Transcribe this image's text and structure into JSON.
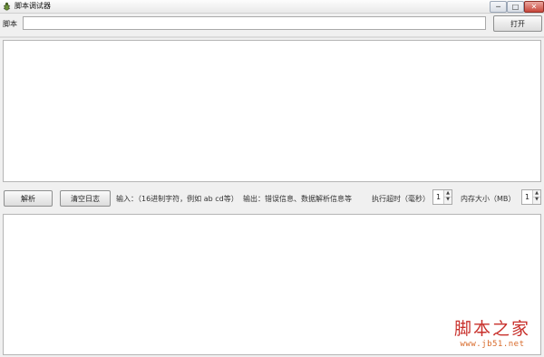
{
  "window": {
    "title": "脚本调试器",
    "icon": "bug-icon",
    "controls": {
      "minimize": "─",
      "maximize": "□",
      "close": "✕"
    }
  },
  "script_row": {
    "label": "脚本",
    "input_value": "",
    "open_button": "打开"
  },
  "toolbar": {
    "parse_button": "解析",
    "clear_log_button": "清空日志",
    "input_hint": "输入：（16进制字符，例如 ab cd等）",
    "output_hint": "输出：错误信息、数据解析信息等",
    "timeout_label": "执行超时（毫秒）",
    "timeout_value": "1",
    "memory_label": "内存大小（MB）",
    "memory_value": "1"
  },
  "watermark": {
    "logo_text": "脚本之家",
    "url": "www.jb51.net"
  },
  "colors": {
    "watermark_red": "#c8302b",
    "watermark_orange": "#d86a2a",
    "close_button": "#c8463a"
  }
}
